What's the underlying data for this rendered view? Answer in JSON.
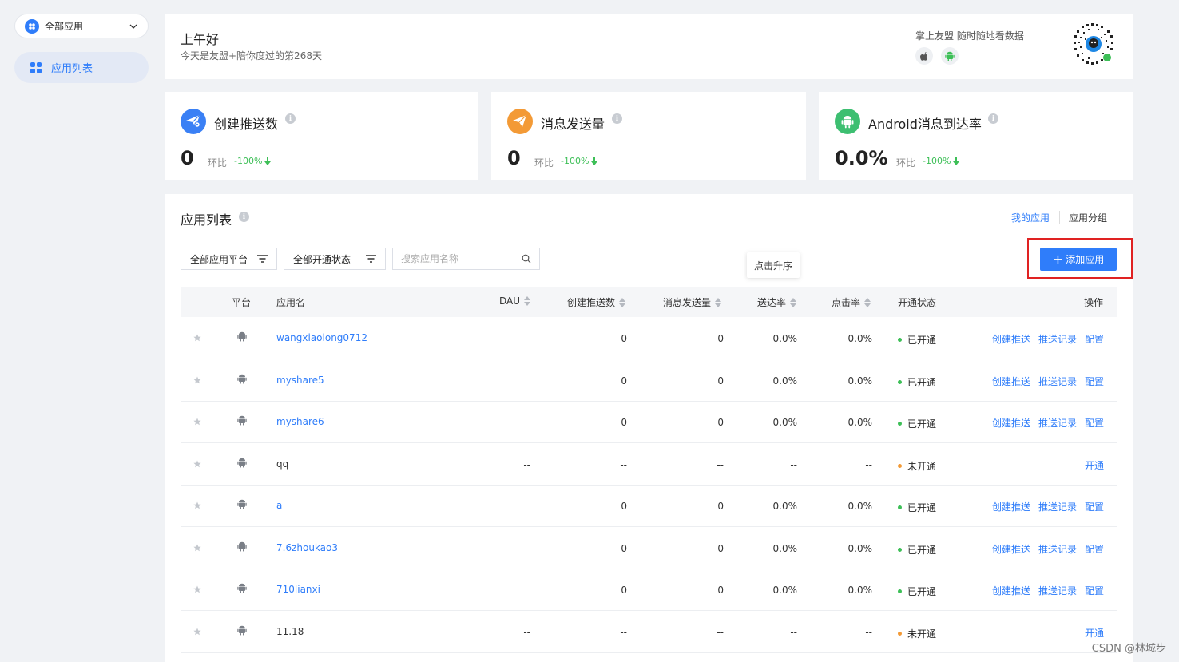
{
  "sidebar": {
    "app_selector": "全部应用",
    "nav_item": "应用列表"
  },
  "greeting": {
    "title": "上午好",
    "subtitle": "今天是友盟+陪你度过的第268天",
    "promo": "掌上友盟 随时随地看数据"
  },
  "stats": [
    {
      "title": "创建推送数",
      "value": "0",
      "compare_label": "环比",
      "change": "-100%",
      "icon": "paper-plane-gear-icon",
      "color": "#3a80f5"
    },
    {
      "title": "消息发送量",
      "value": "0",
      "compare_label": "环比",
      "change": "-100%",
      "icon": "paper-plane-icon",
      "color": "#f39a36"
    },
    {
      "title": "Android消息到达率",
      "value": "0.0%",
      "compare_label": "环比",
      "change": "-100%",
      "icon": "android-icon",
      "color": "#3dbf71"
    }
  ],
  "list": {
    "title": "应用列表",
    "tab_my": "我的应用",
    "tab_group": "应用分组",
    "filter_platform": "全部应用平台",
    "filter_status": "全部开通状态",
    "search_placeholder": "搜索应用名称",
    "tooltip": "点击升序",
    "add_button": "添加应用",
    "columns": {
      "platform": "平台",
      "name": "应用名",
      "dau": "DAU",
      "create_push": "创建推送数",
      "send": "消息发送量",
      "arrival": "送达率",
      "click": "点击率",
      "status": "开通状态",
      "action": "操作"
    },
    "rows": [
      {
        "name": "wangxiaolong0712",
        "dau": "",
        "create": "0",
        "send": "0",
        "arrival": "0.0%",
        "click": "0.0%",
        "status": "已开通",
        "a1": "创建推送",
        "a2": "推送记录",
        "a3": "配置"
      },
      {
        "name": "myshare5",
        "dau": "",
        "create": "0",
        "send": "0",
        "arrival": "0.0%",
        "click": "0.0%",
        "status": "已开通",
        "a1": "创建推送",
        "a2": "推送记录",
        "a3": "配置"
      },
      {
        "name": "myshare6",
        "dau": "",
        "create": "0",
        "send": "0",
        "arrival": "0.0%",
        "click": "0.0%",
        "status": "已开通",
        "a1": "创建推送",
        "a2": "推送记录",
        "a3": "配置"
      },
      {
        "name": "qq",
        "dau": "--",
        "create": "--",
        "send": "--",
        "arrival": "--",
        "click": "--",
        "status": "未开通",
        "a1": "",
        "a2": "",
        "a3": "开通"
      },
      {
        "name": "a",
        "dau": "",
        "create": "0",
        "send": "0",
        "arrival": "0.0%",
        "click": "0.0%",
        "status": "已开通",
        "a1": "创建推送",
        "a2": "推送记录",
        "a3": "配置"
      },
      {
        "name": "7.6zhoukao3",
        "dau": "",
        "create": "0",
        "send": "0",
        "arrival": "0.0%",
        "click": "0.0%",
        "status": "已开通",
        "a1": "创建推送",
        "a2": "推送记录",
        "a3": "配置"
      },
      {
        "name": "710lianxi",
        "dau": "",
        "create": "0",
        "send": "0",
        "arrival": "0.0%",
        "click": "0.0%",
        "status": "已开通",
        "a1": "创建推送",
        "a2": "推送记录",
        "a3": "配置"
      },
      {
        "name": "11.18",
        "dau": "--",
        "create": "--",
        "send": "--",
        "arrival": "--",
        "click": "--",
        "status": "未开通",
        "a1": "",
        "a2": "",
        "a3": "开通"
      }
    ]
  },
  "colors": {
    "accent": "#2f7dfa",
    "active": "#3dbf57",
    "inactive": "#f39a36"
  },
  "watermark": "CSDN @林城步"
}
